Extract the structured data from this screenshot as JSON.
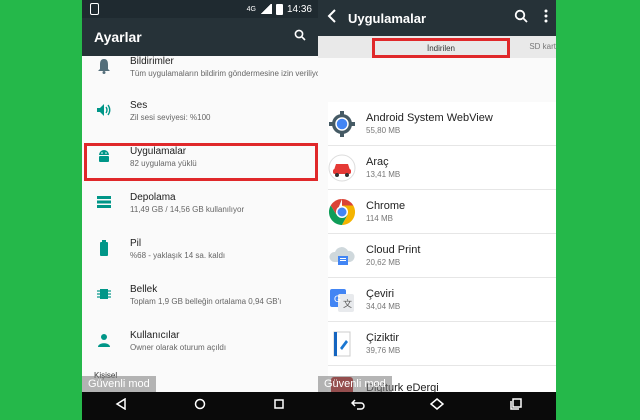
{
  "left": {
    "status_time": "14:36",
    "status_net": "4G",
    "title": "Ayarlar",
    "items": [
      {
        "title": "Bildirimler",
        "subtitle": "Tüm uygulamaların bildirim göndermesine izin veriliyor"
      },
      {
        "title": "Ses",
        "subtitle": "Zil sesi seviyesi: %100"
      },
      {
        "title": "Uygulamalar",
        "subtitle": "82 uygulama yüklü"
      },
      {
        "title": "Depolama",
        "subtitle": "11,49 GB / 14,56 GB kullanılıyor"
      },
      {
        "title": "Pil",
        "subtitle": "%68 - yaklaşık 14 sa. kaldı"
      },
      {
        "title": "Bellek",
        "subtitle": "Toplam 1,9 GB belleğin ortalama 0,94 GB'ı"
      },
      {
        "title": "Kullanıcılar",
        "subtitle": "Owner olarak oturum açıldı"
      },
      {
        "title": "Kişisel",
        "subtitle": ""
      }
    ],
    "safe_mode": "Güvenli mod"
  },
  "right": {
    "title": "Uygulamalar",
    "tabs": {
      "downloaded": "İndirilen",
      "sd": "SD kart"
    },
    "apps": [
      {
        "name": "Android System WebView",
        "size": "55,80 MB"
      },
      {
        "name": "Araç",
        "size": "13,41 MB"
      },
      {
        "name": "Chrome",
        "size": "114 MB"
      },
      {
        "name": "Cloud Print",
        "size": "20,62 MB"
      },
      {
        "name": "Çeviri",
        "size": "34,04 MB"
      },
      {
        "name": "Çiziktir",
        "size": "39,76 MB"
      },
      {
        "name": "Digiturk eDergi",
        "size": ""
      }
    ],
    "safe_mode": "Güvenli mod"
  },
  "colors": {
    "toolbar": "#263238",
    "highlight": "#e0282a",
    "background": "#25b84a"
  }
}
